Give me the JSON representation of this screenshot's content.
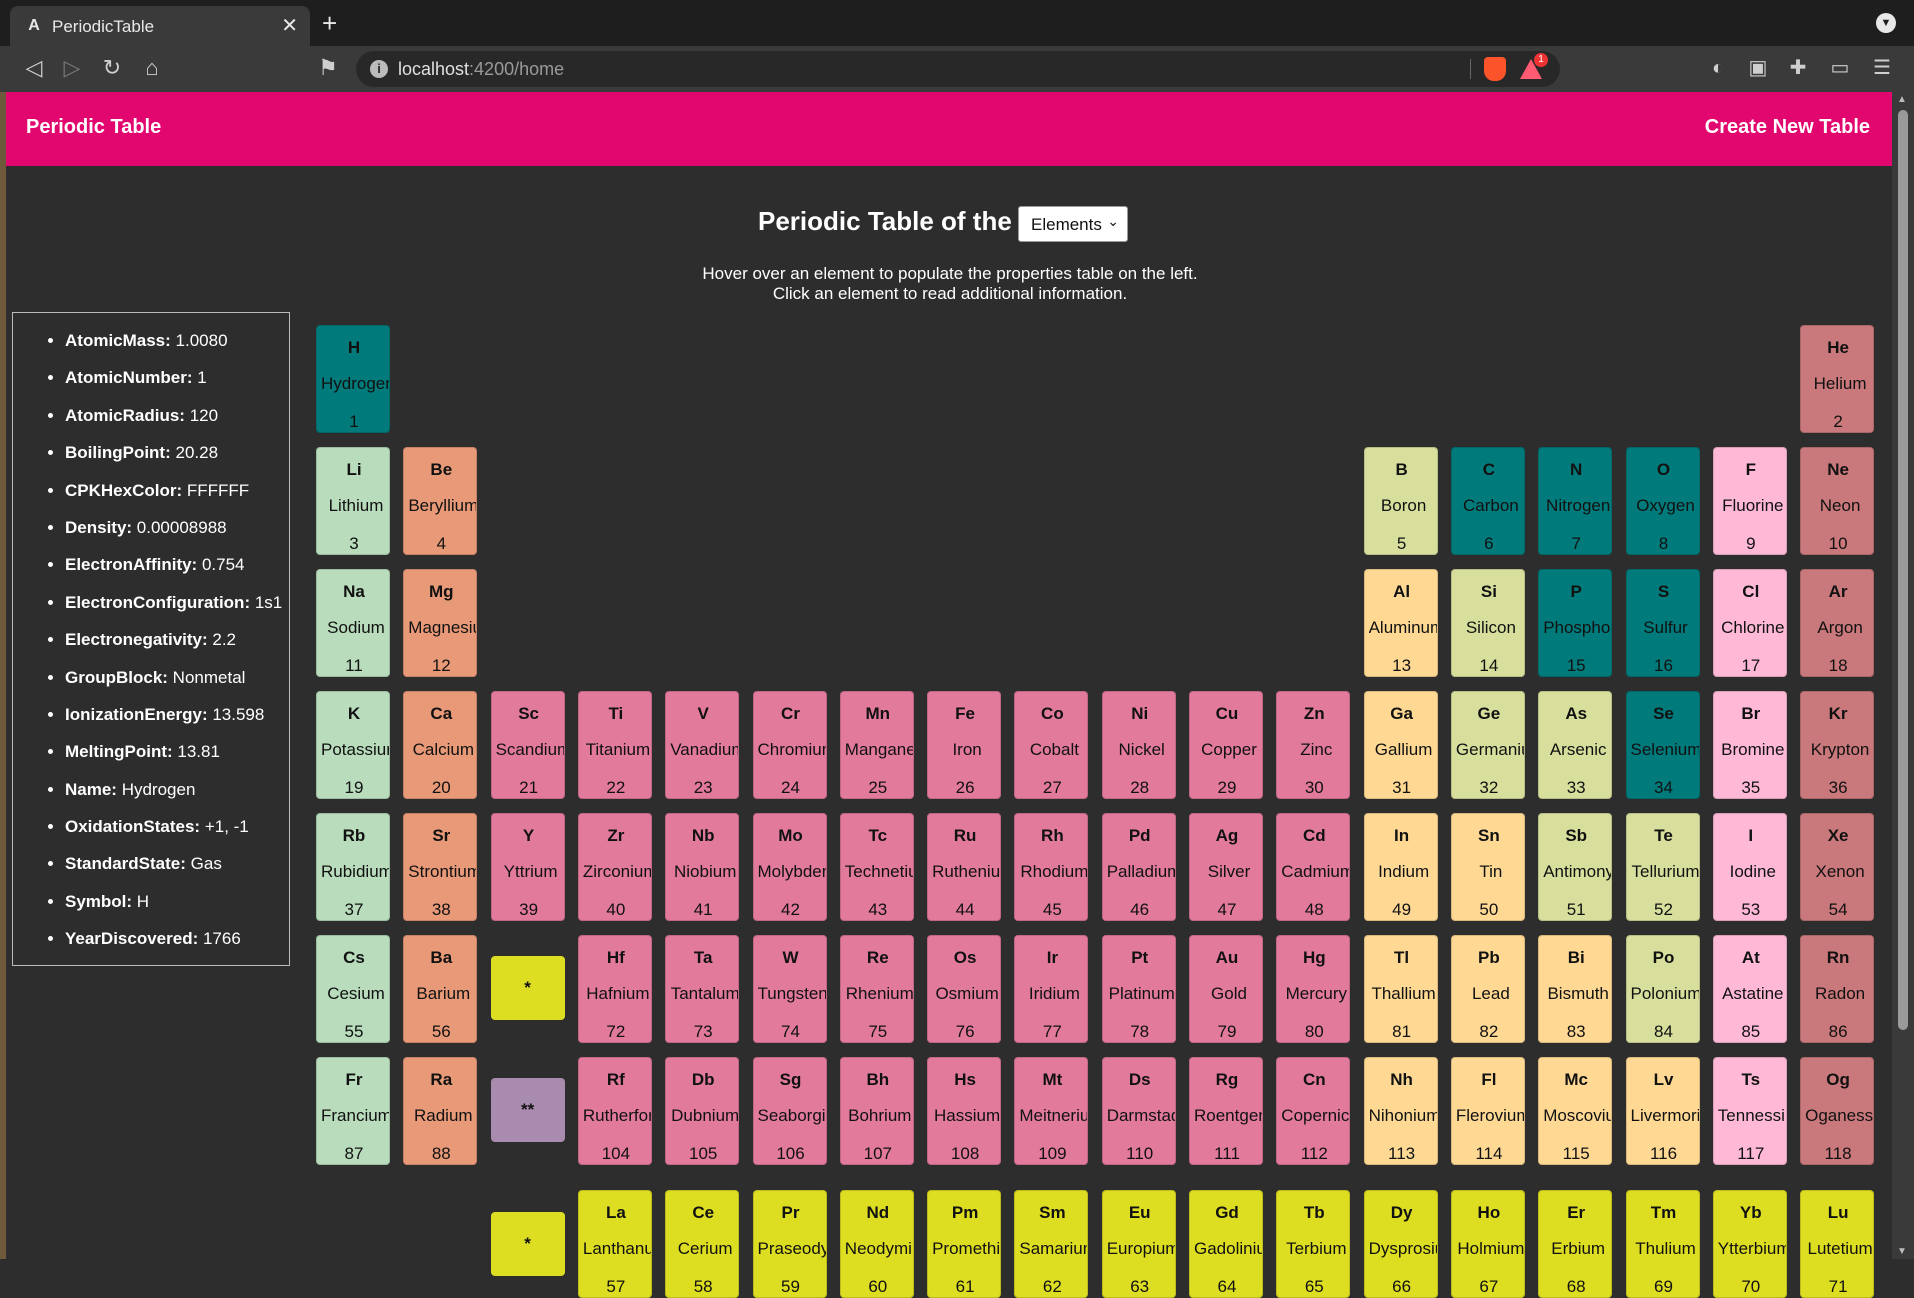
{
  "browser": {
    "tab_title": "PeriodicTable",
    "url_host": "localhost",
    "url_path": ":4200/home",
    "reward_count": "1"
  },
  "app": {
    "brand": "Periodic Table",
    "create_link": "Create New Table",
    "heading": "Periodic Table of the",
    "select_value": "Elements",
    "instruction_line1": "Hover over an element to populate the properties table on the left.",
    "instruction_line2": "Click an element to read additional information."
  },
  "properties": [
    {
      "key": "AtomicMass:",
      "value": " 1.0080"
    },
    {
      "key": "AtomicNumber:",
      "value": " 1"
    },
    {
      "key": "AtomicRadius:",
      "value": " 120"
    },
    {
      "key": "BoilingPoint:",
      "value": " 20.28"
    },
    {
      "key": "CPKHexColor:",
      "value": " FFFFFF"
    },
    {
      "key": "Density:",
      "value": " 0.00008988"
    },
    {
      "key": "ElectronAffinity:",
      "value": " 0.754"
    },
    {
      "key": "ElectronConfiguration:",
      "value": " 1s1"
    },
    {
      "key": "Electronegativity:",
      "value": " 2.2"
    },
    {
      "key": "GroupBlock:",
      "value": " Nonmetal"
    },
    {
      "key": "IonizationEnergy:",
      "value": " 13.598"
    },
    {
      "key": "MeltingPoint:",
      "value": " 13.81"
    },
    {
      "key": "Name:",
      "value": " Hydrogen"
    },
    {
      "key": "OxidationStates:",
      "value": " +1, -1"
    },
    {
      "key": "StandardState:",
      "value": " Gas"
    },
    {
      "key": "Symbol:",
      "value": " H"
    },
    {
      "key": "YearDiscovered:",
      "value": " 1766"
    }
  ],
  "colors": {
    "nonmetal": "#007a7a",
    "noble": "#c9787b",
    "alkali": "#b8dcbc",
    "alkaline": "#e89a78",
    "metalloid": "#d8df9c",
    "halogen": "#ffb9d6",
    "transition": "#e27a9c",
    "post": "#ffd994",
    "lanthanide": "#dddd22",
    "actinide": "#a98bb0"
  },
  "elements": [
    {
      "sym": "H",
      "name": "Hydrogen",
      "num": 1,
      "period": 1,
      "group": 1,
      "cat": "nonmetal"
    },
    {
      "sym": "He",
      "name": "Helium",
      "num": 2,
      "period": 1,
      "group": 18,
      "cat": "noble"
    },
    {
      "sym": "Li",
      "name": "Lithium",
      "num": 3,
      "period": 2,
      "group": 1,
      "cat": "alkali"
    },
    {
      "sym": "Be",
      "name": "Beryllium",
      "num": 4,
      "period": 2,
      "group": 2,
      "cat": "alkaline"
    },
    {
      "sym": "B",
      "name": "Boron",
      "num": 5,
      "period": 2,
      "group": 13,
      "cat": "metalloid"
    },
    {
      "sym": "C",
      "name": "Carbon",
      "num": 6,
      "period": 2,
      "group": 14,
      "cat": "nonmetal"
    },
    {
      "sym": "N",
      "name": "Nitrogen",
      "num": 7,
      "period": 2,
      "group": 15,
      "cat": "nonmetal"
    },
    {
      "sym": "O",
      "name": "Oxygen",
      "num": 8,
      "period": 2,
      "group": 16,
      "cat": "nonmetal"
    },
    {
      "sym": "F",
      "name": "Fluorine",
      "num": 9,
      "period": 2,
      "group": 17,
      "cat": "halogen"
    },
    {
      "sym": "Ne",
      "name": "Neon",
      "num": 10,
      "period": 2,
      "group": 18,
      "cat": "noble"
    },
    {
      "sym": "Na",
      "name": "Sodium",
      "num": 11,
      "period": 3,
      "group": 1,
      "cat": "alkali"
    },
    {
      "sym": "Mg",
      "name": "Magnesium",
      "num": 12,
      "period": 3,
      "group": 2,
      "cat": "alkaline"
    },
    {
      "sym": "Al",
      "name": "Aluminum",
      "num": 13,
      "period": 3,
      "group": 13,
      "cat": "post"
    },
    {
      "sym": "Si",
      "name": "Silicon",
      "num": 14,
      "period": 3,
      "group": 14,
      "cat": "metalloid"
    },
    {
      "sym": "P",
      "name": "Phosphorus",
      "num": 15,
      "period": 3,
      "group": 15,
      "cat": "nonmetal"
    },
    {
      "sym": "S",
      "name": "Sulfur",
      "num": 16,
      "period": 3,
      "group": 16,
      "cat": "nonmetal"
    },
    {
      "sym": "Cl",
      "name": "Chlorine",
      "num": 17,
      "period": 3,
      "group": 17,
      "cat": "halogen"
    },
    {
      "sym": "Ar",
      "name": "Argon",
      "num": 18,
      "period": 3,
      "group": 18,
      "cat": "noble"
    },
    {
      "sym": "K",
      "name": "Potassium",
      "num": 19,
      "period": 4,
      "group": 1,
      "cat": "alkali"
    },
    {
      "sym": "Ca",
      "name": "Calcium",
      "num": 20,
      "period": 4,
      "group": 2,
      "cat": "alkaline"
    },
    {
      "sym": "Sc",
      "name": "Scandium",
      "num": 21,
      "period": 4,
      "group": 3,
      "cat": "transition"
    },
    {
      "sym": "Ti",
      "name": "Titanium",
      "num": 22,
      "period": 4,
      "group": 4,
      "cat": "transition"
    },
    {
      "sym": "V",
      "name": "Vanadium",
      "num": 23,
      "period": 4,
      "group": 5,
      "cat": "transition"
    },
    {
      "sym": "Cr",
      "name": "Chromium",
      "num": 24,
      "period": 4,
      "group": 6,
      "cat": "transition"
    },
    {
      "sym": "Mn",
      "name": "Manganese",
      "num": 25,
      "period": 4,
      "group": 7,
      "cat": "transition"
    },
    {
      "sym": "Fe",
      "name": "Iron",
      "num": 26,
      "period": 4,
      "group": 8,
      "cat": "transition"
    },
    {
      "sym": "Co",
      "name": "Cobalt",
      "num": 27,
      "period": 4,
      "group": 9,
      "cat": "transition"
    },
    {
      "sym": "Ni",
      "name": "Nickel",
      "num": 28,
      "period": 4,
      "group": 10,
      "cat": "transition"
    },
    {
      "sym": "Cu",
      "name": "Copper",
      "num": 29,
      "period": 4,
      "group": 11,
      "cat": "transition"
    },
    {
      "sym": "Zn",
      "name": "Zinc",
      "num": 30,
      "period": 4,
      "group": 12,
      "cat": "transition"
    },
    {
      "sym": "Ga",
      "name": "Gallium",
      "num": 31,
      "period": 4,
      "group": 13,
      "cat": "post"
    },
    {
      "sym": "Ge",
      "name": "Germanium",
      "num": 32,
      "period": 4,
      "group": 14,
      "cat": "metalloid"
    },
    {
      "sym": "As",
      "name": "Arsenic",
      "num": 33,
      "period": 4,
      "group": 15,
      "cat": "metalloid"
    },
    {
      "sym": "Se",
      "name": "Selenium",
      "num": 34,
      "period": 4,
      "group": 16,
      "cat": "nonmetal"
    },
    {
      "sym": "Br",
      "name": "Bromine",
      "num": 35,
      "period": 4,
      "group": 17,
      "cat": "halogen"
    },
    {
      "sym": "Kr",
      "name": "Krypton",
      "num": 36,
      "period": 4,
      "group": 18,
      "cat": "noble"
    },
    {
      "sym": "Rb",
      "name": "Rubidium",
      "num": 37,
      "period": 5,
      "group": 1,
      "cat": "alkali"
    },
    {
      "sym": "Sr",
      "name": "Strontium",
      "num": 38,
      "period": 5,
      "group": 2,
      "cat": "alkaline"
    },
    {
      "sym": "Y",
      "name": "Yttrium",
      "num": 39,
      "period": 5,
      "group": 3,
      "cat": "transition"
    },
    {
      "sym": "Zr",
      "name": "Zirconium",
      "num": 40,
      "period": 5,
      "group": 4,
      "cat": "transition"
    },
    {
      "sym": "Nb",
      "name": "Niobium",
      "num": 41,
      "period": 5,
      "group": 5,
      "cat": "transition"
    },
    {
      "sym": "Mo",
      "name": "Molybdenum",
      "num": 42,
      "period": 5,
      "group": 6,
      "cat": "transition"
    },
    {
      "sym": "Tc",
      "name": "Technetium",
      "num": 43,
      "period": 5,
      "group": 7,
      "cat": "transition"
    },
    {
      "sym": "Ru",
      "name": "Ruthenium",
      "num": 44,
      "period": 5,
      "group": 8,
      "cat": "transition"
    },
    {
      "sym": "Rh",
      "name": "Rhodium",
      "num": 45,
      "period": 5,
      "group": 9,
      "cat": "transition"
    },
    {
      "sym": "Pd",
      "name": "Palladium",
      "num": 46,
      "period": 5,
      "group": 10,
      "cat": "transition"
    },
    {
      "sym": "Ag",
      "name": "Silver",
      "num": 47,
      "period": 5,
      "group": 11,
      "cat": "transition"
    },
    {
      "sym": "Cd",
      "name": "Cadmium",
      "num": 48,
      "period": 5,
      "group": 12,
      "cat": "transition"
    },
    {
      "sym": "In",
      "name": "Indium",
      "num": 49,
      "period": 5,
      "group": 13,
      "cat": "post"
    },
    {
      "sym": "Sn",
      "name": "Tin",
      "num": 50,
      "period": 5,
      "group": 14,
      "cat": "post"
    },
    {
      "sym": "Sb",
      "name": "Antimony",
      "num": 51,
      "period": 5,
      "group": 15,
      "cat": "metalloid"
    },
    {
      "sym": "Te",
      "name": "Tellurium",
      "num": 52,
      "period": 5,
      "group": 16,
      "cat": "metalloid"
    },
    {
      "sym": "I",
      "name": "Iodine",
      "num": 53,
      "period": 5,
      "group": 17,
      "cat": "halogen"
    },
    {
      "sym": "Xe",
      "name": "Xenon",
      "num": 54,
      "period": 5,
      "group": 18,
      "cat": "noble"
    },
    {
      "sym": "Cs",
      "name": "Cesium",
      "num": 55,
      "period": 6,
      "group": 1,
      "cat": "alkali"
    },
    {
      "sym": "Ba",
      "name": "Barium",
      "num": 56,
      "period": 6,
      "group": 2,
      "cat": "alkaline"
    },
    {
      "sym": "Hf",
      "name": "Hafnium",
      "num": 72,
      "period": 6,
      "group": 4,
      "cat": "transition"
    },
    {
      "sym": "Ta",
      "name": "Tantalum",
      "num": 73,
      "period": 6,
      "group": 5,
      "cat": "transition"
    },
    {
      "sym": "W",
      "name": "Tungsten",
      "num": 74,
      "period": 6,
      "group": 6,
      "cat": "transition"
    },
    {
      "sym": "Re",
      "name": "Rhenium",
      "num": 75,
      "period": 6,
      "group": 7,
      "cat": "transition"
    },
    {
      "sym": "Os",
      "name": "Osmium",
      "num": 76,
      "period": 6,
      "group": 8,
      "cat": "transition"
    },
    {
      "sym": "Ir",
      "name": "Iridium",
      "num": 77,
      "period": 6,
      "group": 9,
      "cat": "transition"
    },
    {
      "sym": "Pt",
      "name": "Platinum",
      "num": 78,
      "period": 6,
      "group": 10,
      "cat": "transition"
    },
    {
      "sym": "Au",
      "name": "Gold",
      "num": 79,
      "period": 6,
      "group": 11,
      "cat": "transition"
    },
    {
      "sym": "Hg",
      "name": "Mercury",
      "num": 80,
      "period": 6,
      "group": 12,
      "cat": "transition"
    },
    {
      "sym": "Tl",
      "name": "Thallium",
      "num": 81,
      "period": 6,
      "group": 13,
      "cat": "post"
    },
    {
      "sym": "Pb",
      "name": "Lead",
      "num": 82,
      "period": 6,
      "group": 14,
      "cat": "post"
    },
    {
      "sym": "Bi",
      "name": "Bismuth",
      "num": 83,
      "period": 6,
      "group": 15,
      "cat": "post"
    },
    {
      "sym": "Po",
      "name": "Polonium",
      "num": 84,
      "period": 6,
      "group": 16,
      "cat": "metalloid"
    },
    {
      "sym": "At",
      "name": "Astatine",
      "num": 85,
      "period": 6,
      "group": 17,
      "cat": "halogen"
    },
    {
      "sym": "Rn",
      "name": "Radon",
      "num": 86,
      "period": 6,
      "group": 18,
      "cat": "noble"
    },
    {
      "sym": "Fr",
      "name": "Francium",
      "num": 87,
      "period": 7,
      "group": 1,
      "cat": "alkali"
    },
    {
      "sym": "Ra",
      "name": "Radium",
      "num": 88,
      "period": 7,
      "group": 2,
      "cat": "alkaline"
    },
    {
      "sym": "Rf",
      "name": "Rutherfordium",
      "num": 104,
      "period": 7,
      "group": 4,
      "cat": "transition"
    },
    {
      "sym": "Db",
      "name": "Dubnium",
      "num": 105,
      "period": 7,
      "group": 5,
      "cat": "transition"
    },
    {
      "sym": "Sg",
      "name": "Seaborgium",
      "num": 106,
      "period": 7,
      "group": 6,
      "cat": "transition"
    },
    {
      "sym": "Bh",
      "name": "Bohrium",
      "num": 107,
      "period": 7,
      "group": 7,
      "cat": "transition"
    },
    {
      "sym": "Hs",
      "name": "Hassium",
      "num": 108,
      "period": 7,
      "group": 8,
      "cat": "transition"
    },
    {
      "sym": "Mt",
      "name": "Meitnerium",
      "num": 109,
      "period": 7,
      "group": 9,
      "cat": "transition"
    },
    {
      "sym": "Ds",
      "name": "Darmstadtium",
      "num": 110,
      "period": 7,
      "group": 10,
      "cat": "transition"
    },
    {
      "sym": "Rg",
      "name": "Roentgenium",
      "num": 111,
      "period": 7,
      "group": 11,
      "cat": "transition"
    },
    {
      "sym": "Cn",
      "name": "Copernicium",
      "num": 112,
      "period": 7,
      "group": 12,
      "cat": "transition"
    },
    {
      "sym": "Nh",
      "name": "Nihonium",
      "num": 113,
      "period": 7,
      "group": 13,
      "cat": "post"
    },
    {
      "sym": "Fl",
      "name": "Flerovium",
      "num": 114,
      "period": 7,
      "group": 14,
      "cat": "post"
    },
    {
      "sym": "Mc",
      "name": "Moscovium",
      "num": 115,
      "period": 7,
      "group": 15,
      "cat": "post"
    },
    {
      "sym": "Lv",
      "name": "Livermorium",
      "num": 116,
      "period": 7,
      "group": 16,
      "cat": "post"
    },
    {
      "sym": "Ts",
      "name": "Tennessine",
      "num": 117,
      "period": 7,
      "group": 17,
      "cat": "halogen"
    },
    {
      "sym": "Og",
      "name": "Oganesson",
      "num": 118,
      "period": 7,
      "group": 18,
      "cat": "noble"
    },
    {
      "sym": "La",
      "name": "Lanthanum",
      "num": 57,
      "period": 9,
      "group": 4,
      "cat": "lanthanide"
    },
    {
      "sym": "Ce",
      "name": "Cerium",
      "num": 58,
      "period": 9,
      "group": 5,
      "cat": "lanthanide"
    },
    {
      "sym": "Pr",
      "name": "Praseodymium",
      "num": 59,
      "period": 9,
      "group": 6,
      "cat": "lanthanide"
    },
    {
      "sym": "Nd",
      "name": "Neodymium",
      "num": 60,
      "period": 9,
      "group": 7,
      "cat": "lanthanide"
    },
    {
      "sym": "Pm",
      "name": "Promethium",
      "num": 61,
      "period": 9,
      "group": 8,
      "cat": "lanthanide"
    },
    {
      "sym": "Sm",
      "name": "Samarium",
      "num": 62,
      "period": 9,
      "group": 9,
      "cat": "lanthanide"
    },
    {
      "sym": "Eu",
      "name": "Europium",
      "num": 63,
      "period": 9,
      "group": 10,
      "cat": "lanthanide"
    },
    {
      "sym": "Gd",
      "name": "Gadolinium",
      "num": 64,
      "period": 9,
      "group": 11,
      "cat": "lanthanide"
    },
    {
      "sym": "Tb",
      "name": "Terbium",
      "num": 65,
      "period": 9,
      "group": 12,
      "cat": "lanthanide"
    },
    {
      "sym": "Dy",
      "name": "Dysprosium",
      "num": 66,
      "period": 9,
      "group": 13,
      "cat": "lanthanide"
    },
    {
      "sym": "Ho",
      "name": "Holmium",
      "num": 67,
      "period": 9,
      "group": 14,
      "cat": "lanthanide"
    },
    {
      "sym": "Er",
      "name": "Erbium",
      "num": 68,
      "period": 9,
      "group": 15,
      "cat": "lanthanide"
    },
    {
      "sym": "Tm",
      "name": "Thulium",
      "num": 69,
      "period": 9,
      "group": 16,
      "cat": "lanthanide"
    },
    {
      "sym": "Yb",
      "name": "Ytterbium",
      "num": 70,
      "period": 9,
      "group": 17,
      "cat": "lanthanide"
    },
    {
      "sym": "Lu",
      "name": "Lutetium",
      "num": 71,
      "period": 9,
      "group": 18,
      "cat": "lanthanide"
    }
  ],
  "placeholders": [
    {
      "label": "*",
      "period": 6,
      "cat": "lanthanide"
    },
    {
      "label": "**",
      "period": 7,
      "cat": "actinide"
    },
    {
      "label": "*",
      "period": 9,
      "cat": "lanthanide"
    }
  ]
}
